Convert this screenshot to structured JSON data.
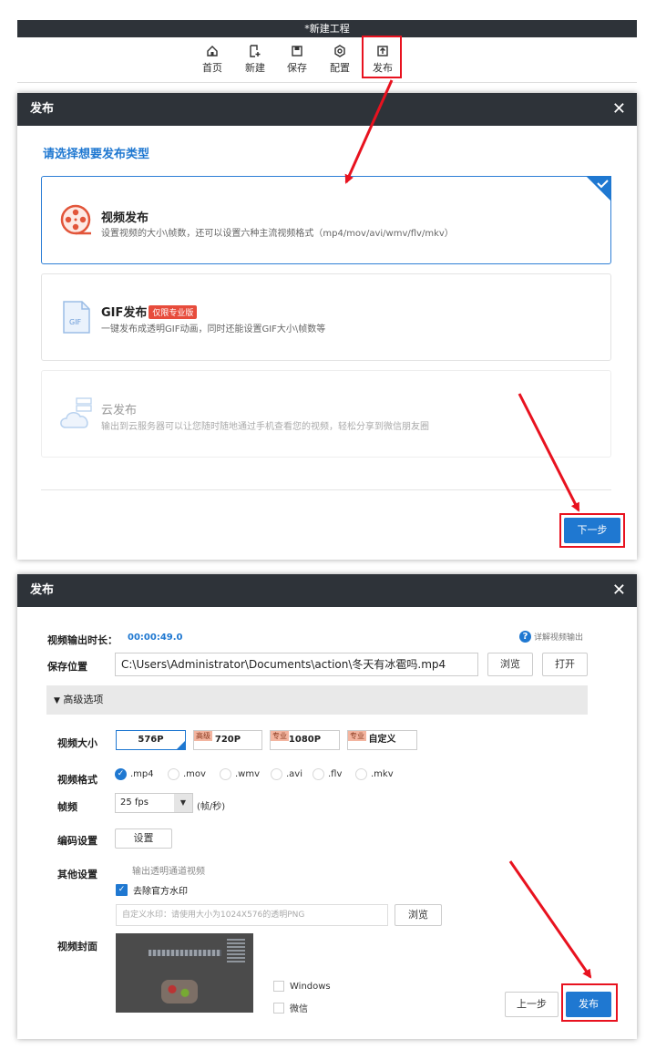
{
  "top_window": {
    "title": "*新建工程",
    "toolbar": [
      {
        "label": "首页",
        "icon": "home-icon"
      },
      {
        "label": "新建",
        "icon": "new-file-icon"
      },
      {
        "label": "保存",
        "icon": "save-icon"
      },
      {
        "label": "配置",
        "icon": "settings-icon"
      },
      {
        "label": "发布",
        "icon": "publish-icon"
      }
    ]
  },
  "dialog1": {
    "title": "发布",
    "close": "✕",
    "prompt": "请选择想要发布类型",
    "options": [
      {
        "title": "视频发布",
        "desc": "设置视频的大小\\帧数，还可以设置六种主流视频格式（mp4/mov/avi/wmv/flv/mkv）",
        "icon": "film-reel-icon",
        "selected": true
      },
      {
        "title": "GIF发布",
        "badge": "仅限专业版",
        "desc": "一键发布成透明GIF动画，同时还能设置GIF大小\\帧数等",
        "icon": "gif-file-icon",
        "selected": false
      },
      {
        "title": "云发布",
        "desc": "输出到云服务器可以让您随时随地通过手机查看您的视频，轻松分享到微信朋友圈",
        "icon": "cloud-server-icon",
        "selected": false,
        "disabled": true
      }
    ],
    "next_button": "下一步"
  },
  "dialog2": {
    "title": "发布",
    "close": "✕",
    "duration_label": "视频输出时长：",
    "duration_value": "00:00:49.0",
    "help_link": "详解视频输出",
    "save_label": "保存位置",
    "save_path": "C:\\Users\\Administrator\\Documents\\action\\冬天有冰雹吗.mp4",
    "browse": "浏览",
    "open": "打开",
    "advanced": "高级选项",
    "size_label": "视频大小",
    "sizes": [
      {
        "label": "576P",
        "tag": "",
        "selected": true
      },
      {
        "label": "720P",
        "tag": "高级",
        "selected": false
      },
      {
        "label": "1080P",
        "tag": "专业",
        "selected": false
      },
      {
        "label": "自定义",
        "tag": "专业",
        "selected": false
      }
    ],
    "format_label": "视频格式",
    "formats": [
      {
        "label": ".mp4",
        "selected": true
      },
      {
        "label": ".mov",
        "selected": false
      },
      {
        "label": ".wmv",
        "selected": false
      },
      {
        "label": ".avi",
        "selected": false
      },
      {
        "label": ".flv",
        "selected": false
      },
      {
        "label": ".mkv",
        "selected": false
      }
    ],
    "fps_label": "帧频",
    "fps_value": "25 fps",
    "fps_unit": "(帧/秒)",
    "encode_label": "编码设置",
    "encode_button": "设置",
    "other_label": "其他设置",
    "alpha_option": "输出透明通道视频",
    "watermark_option": "去除官方水印",
    "watermark_placeholder": "自定义水印：请使用大小为1024X576的透明PNG",
    "watermark_browse": "浏览",
    "cover_label": "视频封面",
    "cover_windows": "Windows",
    "cover_wechat": "微信",
    "prev_button": "上一步",
    "publish_button": "发布"
  },
  "colors": {
    "accent": "#1f78d1",
    "header": "#2e3339",
    "highlight": "#e8121f"
  }
}
